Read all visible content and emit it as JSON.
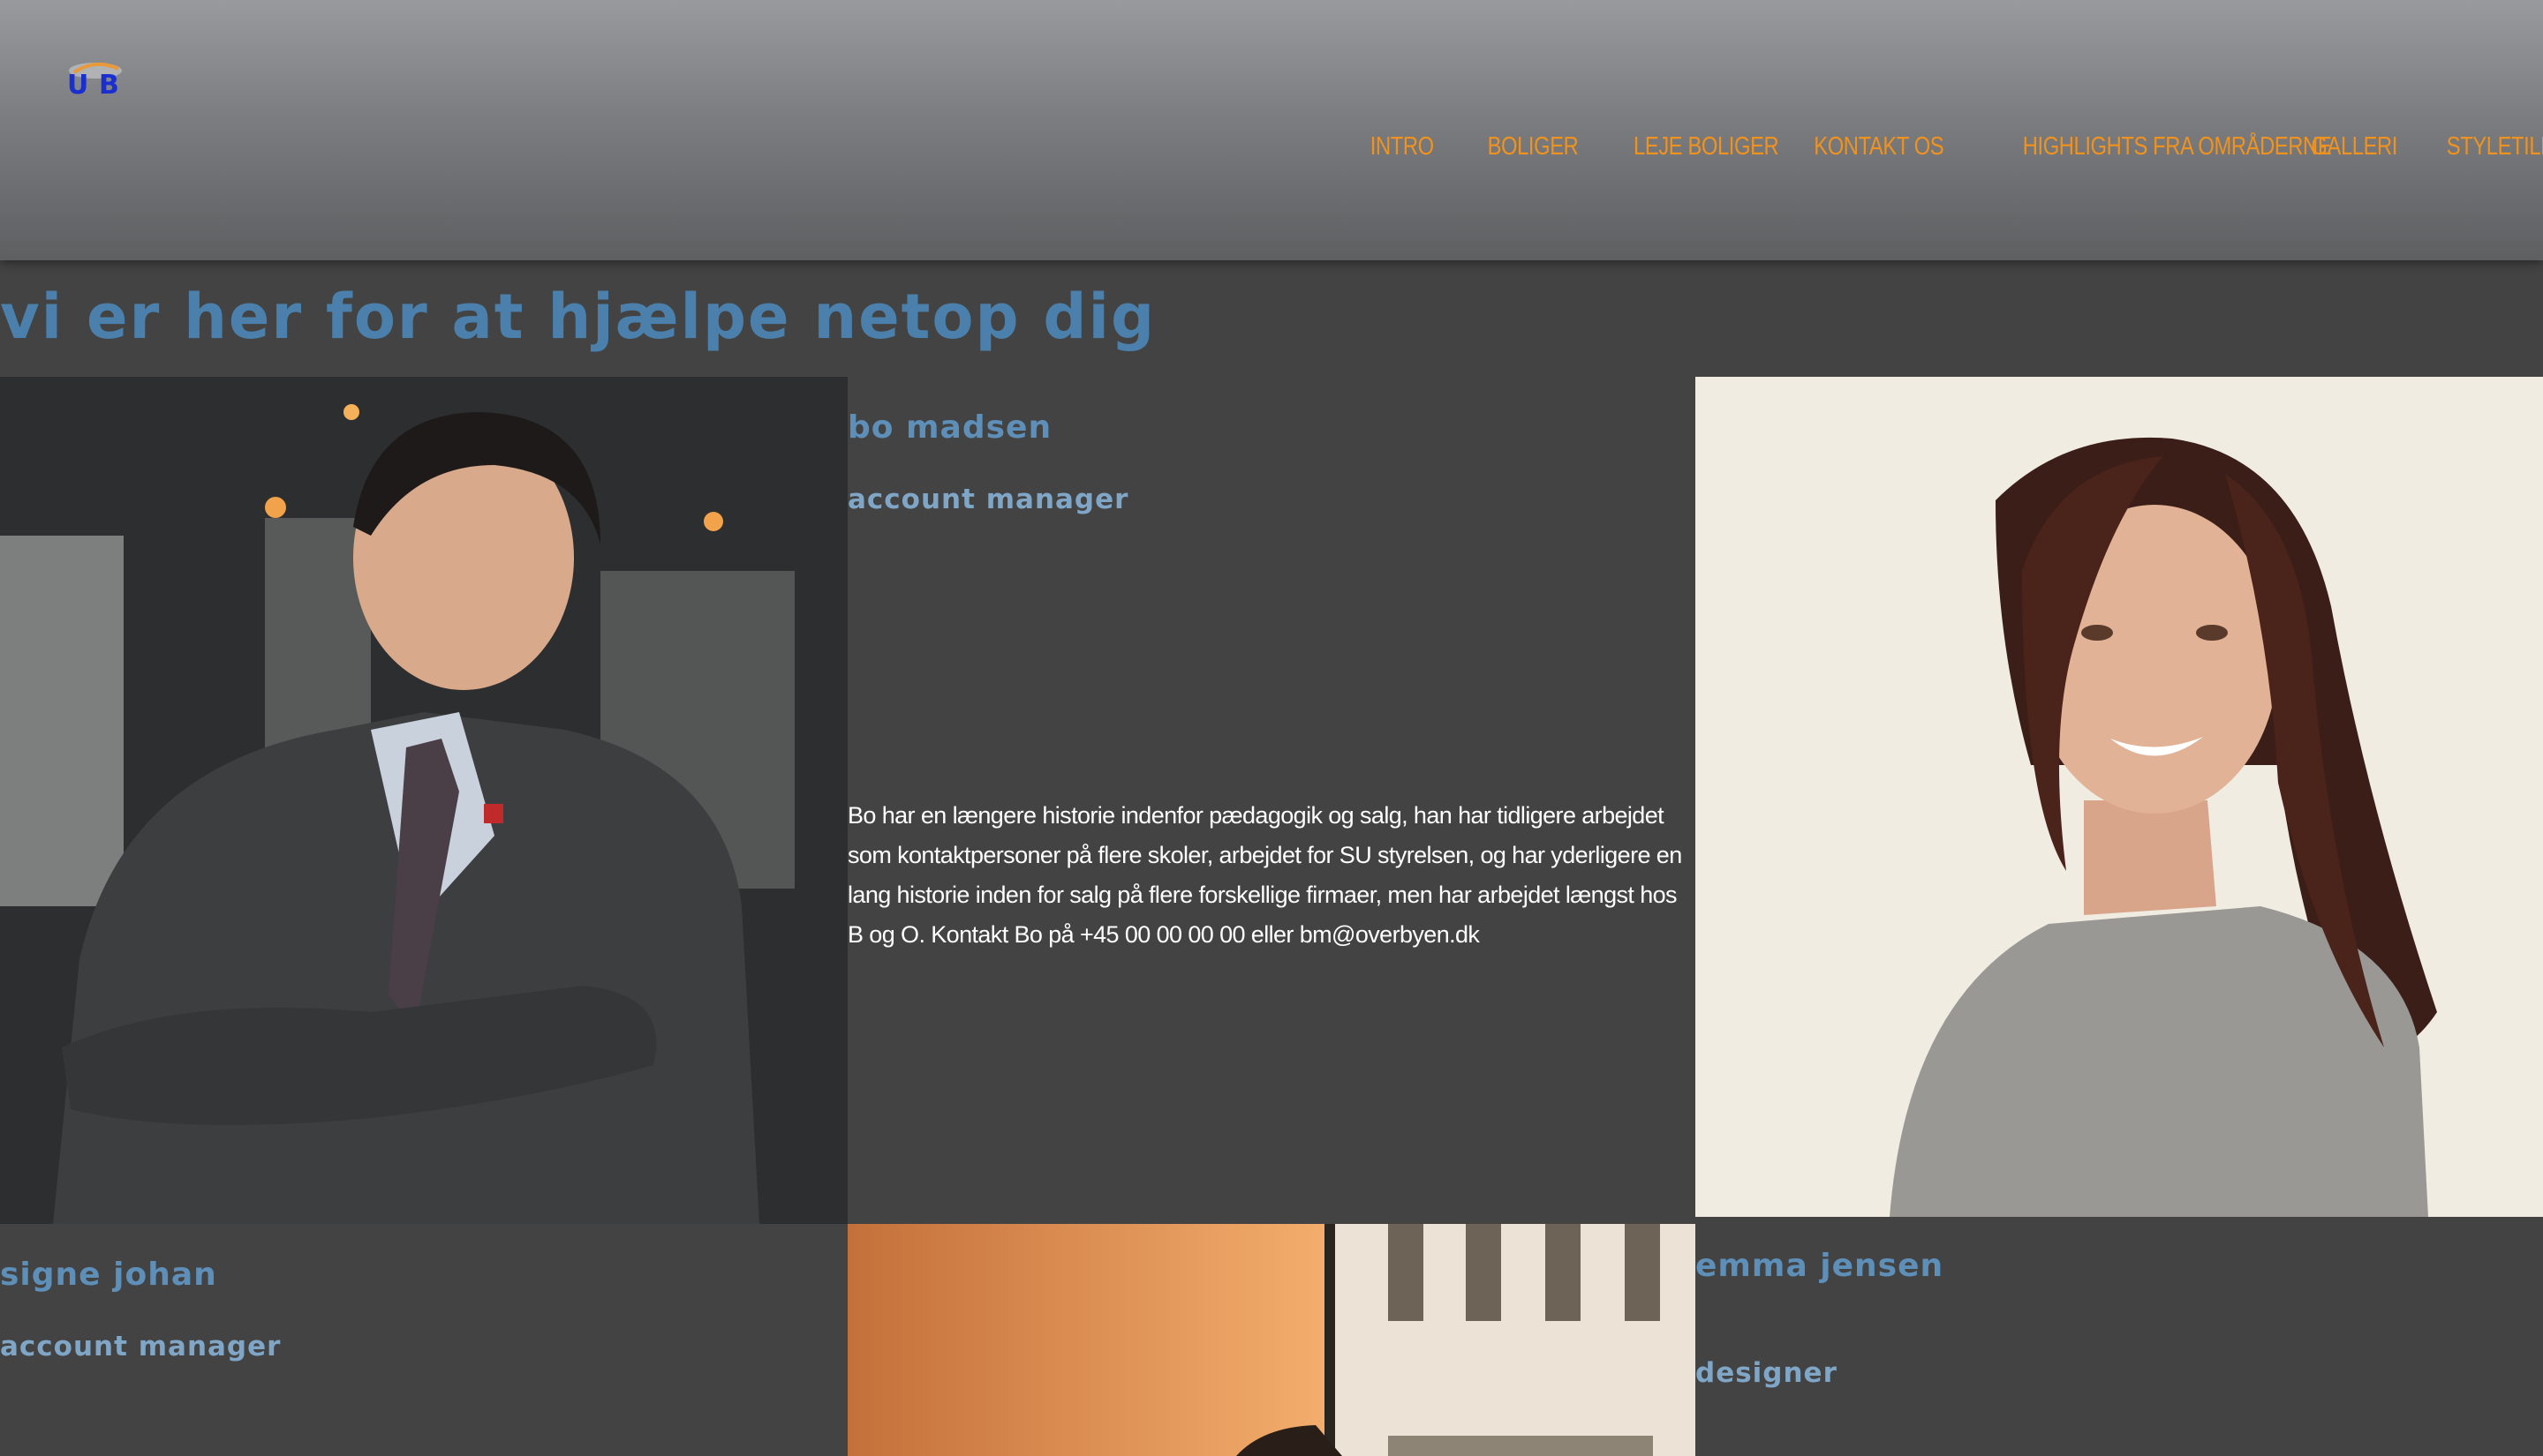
{
  "header": {
    "logo_letters": [
      "U",
      "B"
    ],
    "nav": [
      {
        "label": "INTRO"
      },
      {
        "label": "BOLIGER"
      },
      {
        "label": "LEJE BOLIGER"
      },
      {
        "label": "KONTAKT OS"
      },
      {
        "label": "HIGHLIGHTS FRA OMRÅDERNE"
      },
      {
        "label": "GALLERI"
      },
      {
        "label": "STYLETILE"
      }
    ]
  },
  "main": {
    "title": "Vi er her for at hjælpe netop dig",
    "people": [
      {
        "name": "Bo Madsen",
        "role": "Account Manager",
        "bio": "Bo har en længere historie indenfor pædagogik og salg, han har tidligere arbejdet som kontaktpersoner på flere skoler, arbejdet for SU styrelsen, og har yderligere en lang historie inden for salg på flere forskellige firmaer, men har arbejdet længst hos B og O. Kontakt Bo på +45 00 00 00 00 eller bm@overbyen.dk"
      },
      {
        "name": "Emma Jensen",
        "role": "Designer"
      },
      {
        "name": "Signe Johan",
        "role": "Account Manager"
      }
    ]
  },
  "colors": {
    "background": "#434343",
    "nav_text": "#f0921e",
    "heading_blue": "#4a80ab"
  }
}
